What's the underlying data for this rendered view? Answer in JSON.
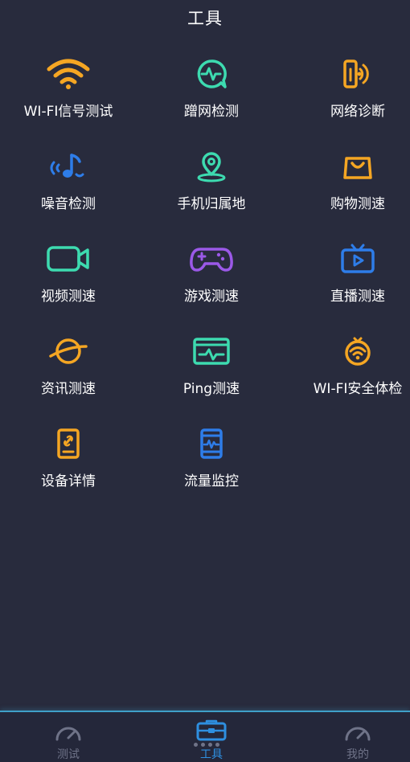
{
  "header": {
    "title": "工具"
  },
  "tools": [
    {
      "label": "WI-FI信号测试",
      "icon": "wifi-icon",
      "color": "#f5a623"
    },
    {
      "label": "蹭网检测",
      "icon": "chat-pulse-icon",
      "color": "#3ddbb0"
    },
    {
      "label": "网络诊断",
      "icon": "signal-device-icon",
      "color": "#f5a623"
    },
    {
      "label": "噪音检测",
      "icon": "music-note-icon",
      "color": "#2e7de9"
    },
    {
      "label": "手机归属地",
      "icon": "location-pin-icon",
      "color": "#3ddbb0"
    },
    {
      "label": "购物测速",
      "icon": "shopping-bag-icon",
      "color": "#f5a623"
    },
    {
      "label": "视频测速",
      "icon": "video-camera-icon",
      "color": "#3ddbb0"
    },
    {
      "label": "游戏测速",
      "icon": "gamepad-icon",
      "color": "#9b59e8"
    },
    {
      "label": "直播测速",
      "icon": "tv-play-icon",
      "color": "#2e7de9"
    },
    {
      "label": "资讯测速",
      "icon": "planet-icon",
      "color": "#f5a623"
    },
    {
      "label": "Ping测速",
      "icon": "monitor-pulse-icon",
      "color": "#3ddbb0"
    },
    {
      "label": "WI-FI安全体检",
      "icon": "wifi-shield-icon",
      "color": "#f5a623"
    },
    {
      "label": "设备详情",
      "icon": "phone-link-icon",
      "color": "#f5a623"
    },
    {
      "label": "流量监控",
      "icon": "phone-pulse-icon",
      "color": "#2e7de9"
    }
  ],
  "bottom_nav": {
    "items": [
      {
        "label": "测试",
        "icon": "speedometer-icon",
        "active": false
      },
      {
        "label": "工具",
        "icon": "toolbox-icon",
        "active": true
      },
      {
        "label": "我的",
        "icon": "speedometer-icon",
        "active": false
      }
    ]
  }
}
